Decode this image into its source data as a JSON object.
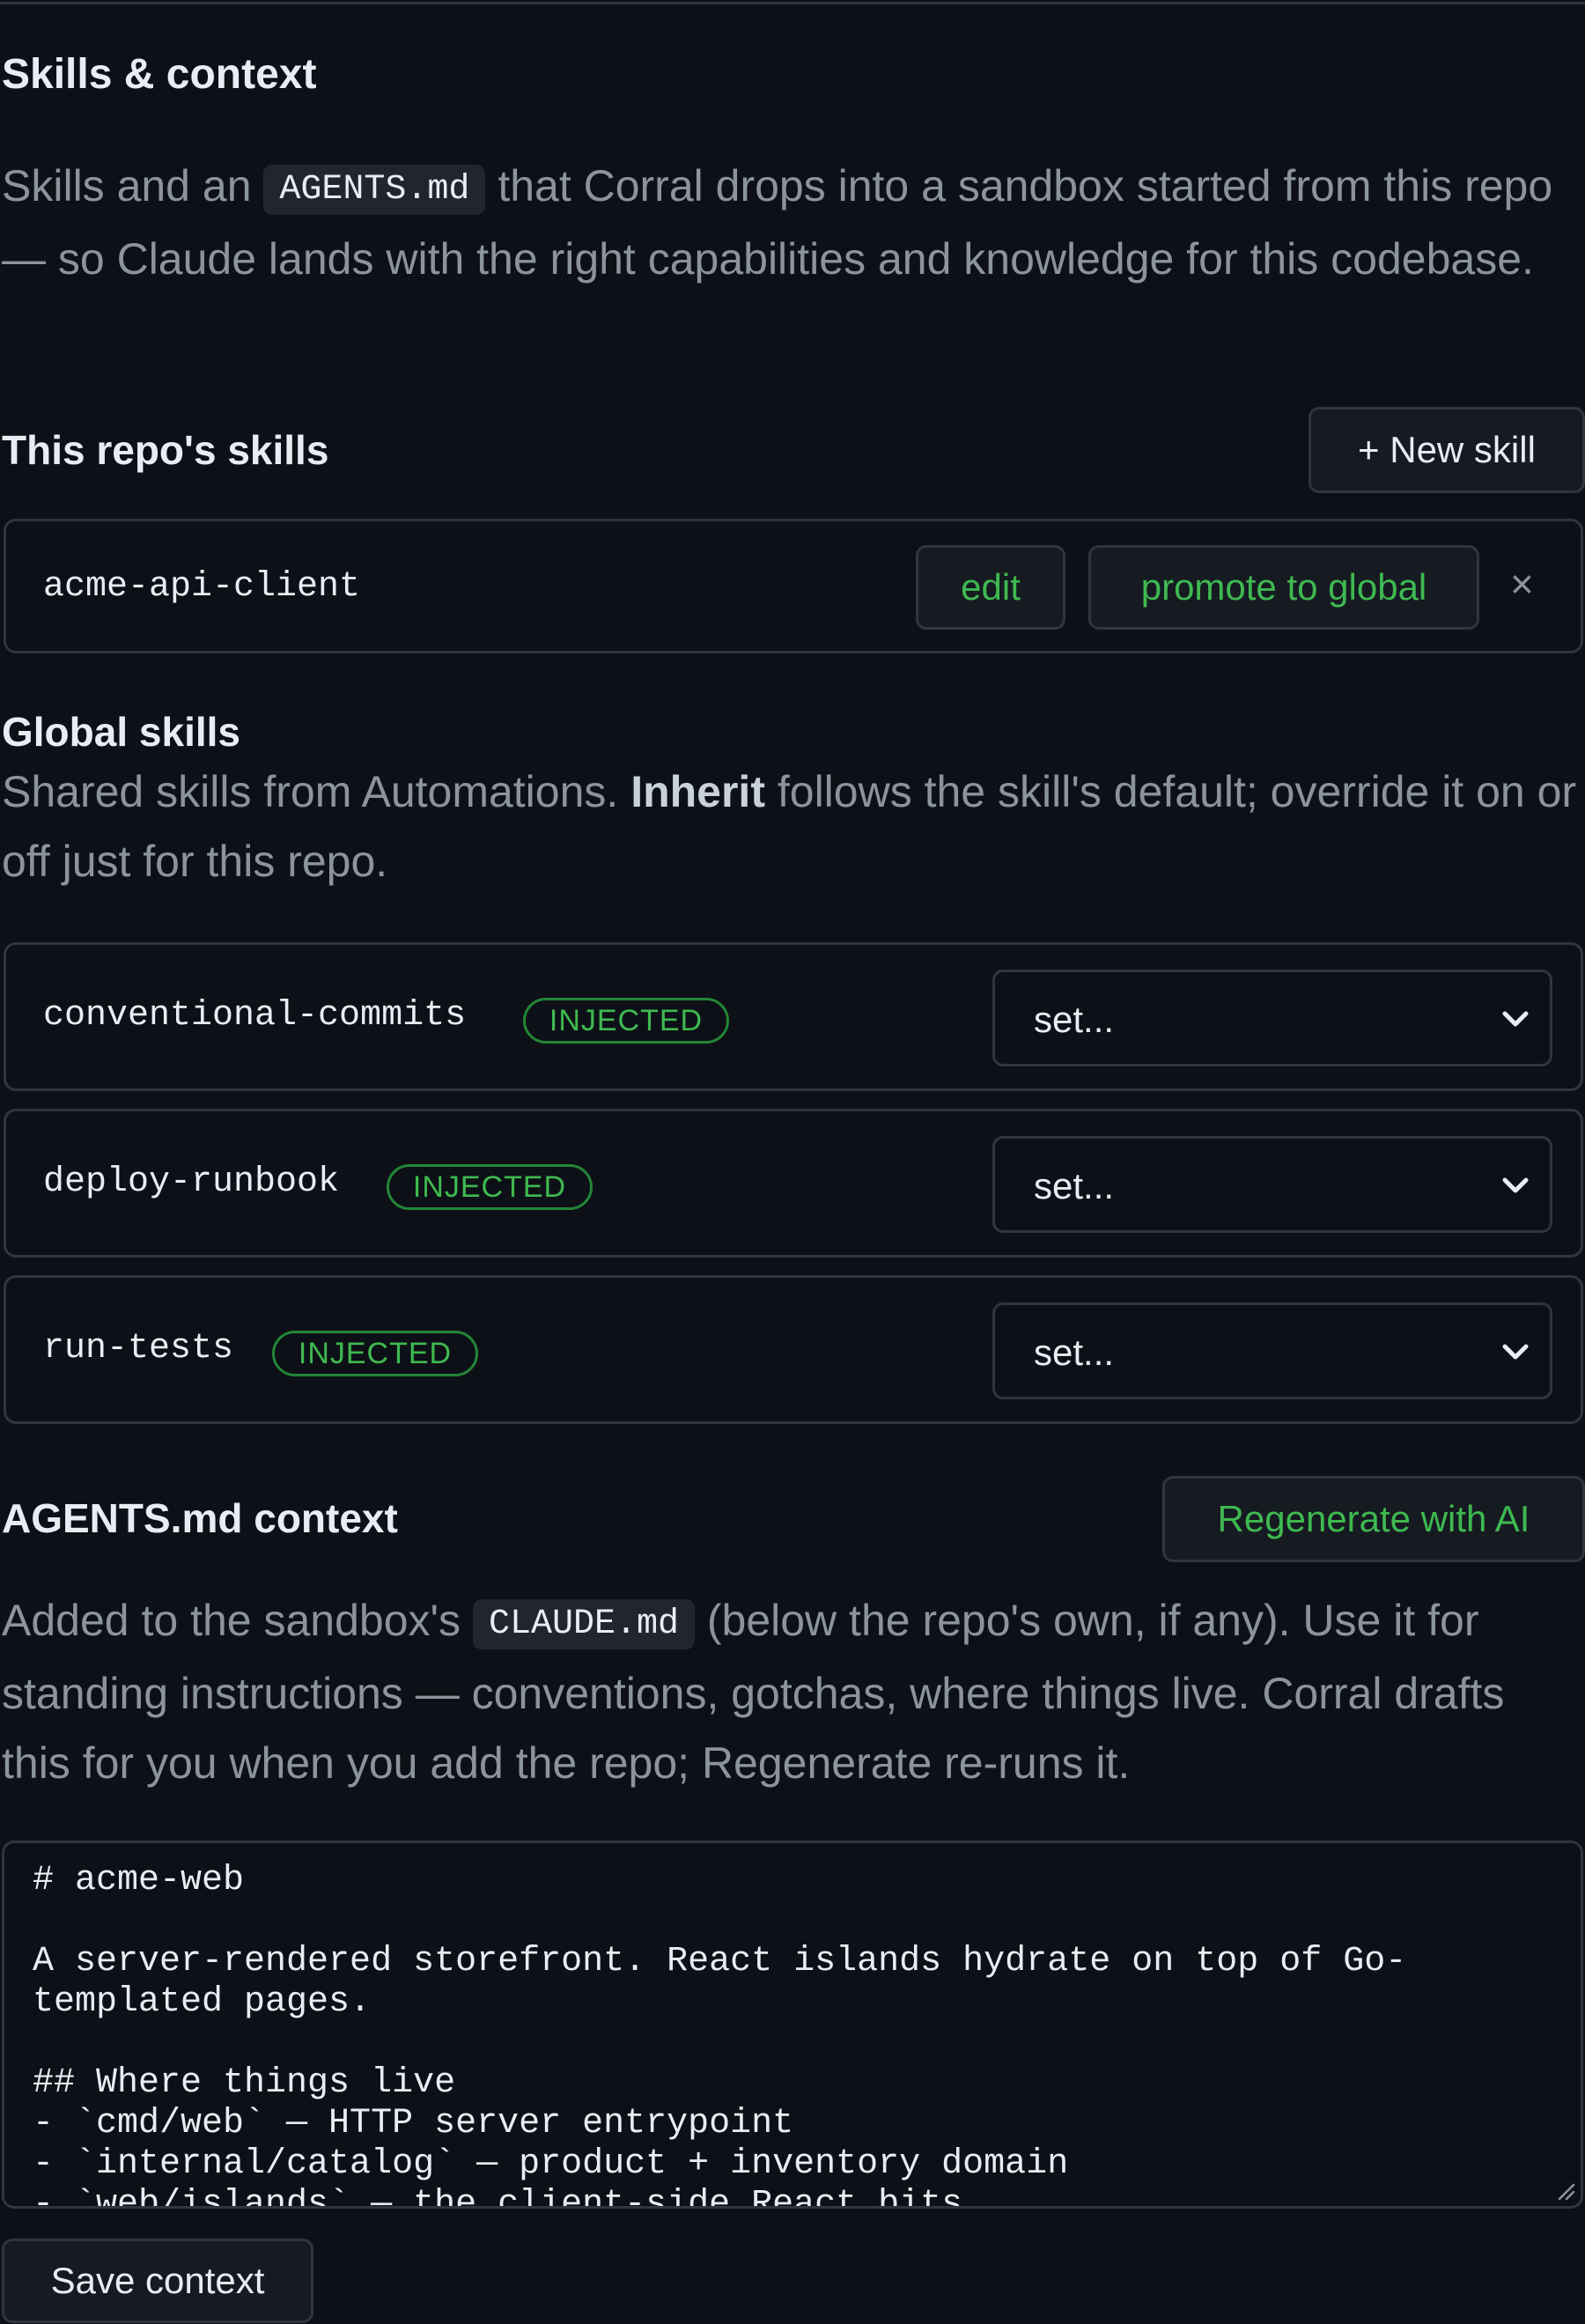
{
  "section": {
    "title": "Skills & context",
    "desc_before": "Skills and an ",
    "desc_code": "AGENTS.md",
    "desc_after": " that Corral drops into a sandbox started from this repo — so Claude lands with the right capabilities and knowledge for this codebase."
  },
  "repo_skills": {
    "title": "This repo's skills",
    "new_button": "+ New skill",
    "items": [
      {
        "name": "acme-api-client",
        "edit_label": "edit",
        "promote_label": "promote to global",
        "remove_label": "×"
      }
    ]
  },
  "global_skills": {
    "title": "Global skills",
    "desc_before": "Shared skills from Automations. ",
    "desc_bold": "Inherit",
    "desc_after": " follows the skill's default; override it on or off just for this repo.",
    "items": [
      {
        "name": "conventional-commits",
        "badge": "INJECTED",
        "select_value": "set..."
      },
      {
        "name": "deploy-runbook",
        "badge": "INJECTED",
        "select_value": "set..."
      },
      {
        "name": "run-tests",
        "badge": "INJECTED",
        "select_value": "set..."
      }
    ]
  },
  "agents_context": {
    "title": "AGENTS.md context",
    "regenerate_button": "Regenerate with AI",
    "desc_before": "Added to the sandbox's ",
    "desc_code": "CLAUDE.md",
    "desc_after": " (below the repo's own, if any). Use it for standing instructions — conventions, gotchas, where things live. Corral drafts this for you when you add the repo; Regenerate re-runs it.",
    "editor_text": "# acme-web\n\nA server-rendered storefront. React islands hydrate on top of Go-templated pages.\n\n## Where things live\n- `cmd/web` — HTTP server entrypoint\n- `internal/catalog` — product + inventory domain\n- `web/islands` — the client-side React bits",
    "save_button": "Save context"
  },
  "colors": {
    "background": "#0d1117",
    "border": "#30363d",
    "accent_green": "#3fb950",
    "muted_text": "#8b949e"
  }
}
